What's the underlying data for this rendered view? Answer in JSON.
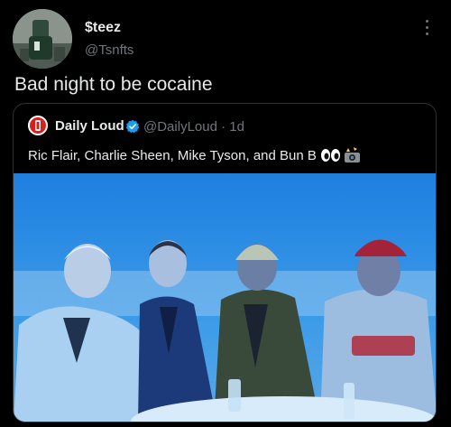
{
  "tweet": {
    "author_name": "$teez",
    "author_handle": "@Tsnfts",
    "text": "Bad night to be cocaine"
  },
  "quoted_tweet": {
    "author_name": "Daily Loud",
    "author_handle": "@DailyLoud",
    "separator": "·",
    "time": "1d",
    "text": "Ric Flair, Charlie Sheen, Mike Tyson, and Bun B",
    "emojis": [
      "eyes-emoji",
      "camera-flash-emoji"
    ],
    "photo_description_icon": "group-photo"
  },
  "colors": {
    "background": "#000000",
    "primary_text": "#e7e9ea",
    "secondary_text": "#71767b",
    "border": "#2f3336",
    "verified_blue": "#1d9bf0",
    "photo_tint": "#2a7fd6"
  }
}
